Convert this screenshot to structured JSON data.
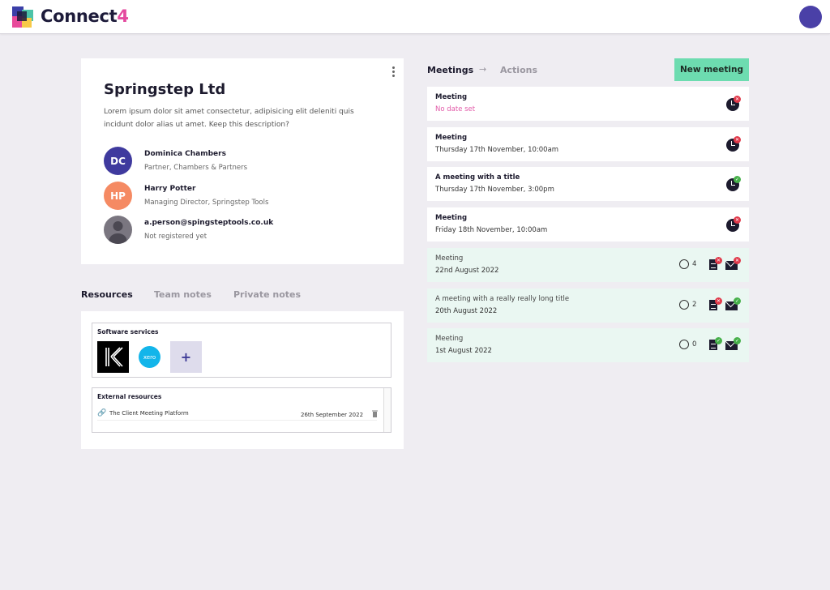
{
  "app": {
    "brand_main": "Connect",
    "brand_accent": "4"
  },
  "company": {
    "name": "Springstep Ltd",
    "description": "Lorem ipsum dolor sit amet consectetur, adipisicing elit deleniti quis incidunt dolor alias ut amet. Keep this description?",
    "contacts": [
      {
        "initials": "DC",
        "name": "Dominica Chambers",
        "role": "Partner, Chambers & Partners",
        "color": "#3f3a9e"
      },
      {
        "initials": "HP",
        "name": "Harry Potter",
        "role": "Managing Director, Springstep Tools",
        "color": "#f58a63"
      },
      {
        "initials": "",
        "name": "a.person@spingsteptools.co.uk",
        "role": "Not registered yet",
        "color": "#7a7680"
      }
    ]
  },
  "tabs": {
    "resources": "Resources",
    "team_notes": "Team notes",
    "private_notes": "Private notes"
  },
  "resources": {
    "software_title": "Software services",
    "xero_label": "xero",
    "add_label": "+",
    "external_title": "External resources",
    "external": [
      {
        "name": "The Client Meeting Platform",
        "date": "26th September 2022"
      }
    ]
  },
  "meetings_header": {
    "meetings": "Meetings",
    "actions": "Actions",
    "arrow": "→",
    "new_button": "New meeting"
  },
  "meetings": [
    {
      "title": "Meeting",
      "date": "No date set",
      "status": "x"
    },
    {
      "title": "Meeting",
      "date": "Thursday 17th November, 10:00am",
      "status": "x"
    },
    {
      "title": "A meeting with a title",
      "date": "Thursday 17th November, 3:00pm",
      "status": "ok"
    },
    {
      "title": "Meeting",
      "date": "Friday 18th November, 10:00am",
      "status": "x"
    }
  ],
  "past_meetings": [
    {
      "title": "Meeting",
      "date": "22nd August 2022",
      "count": "4",
      "doc": "x",
      "mail": "x"
    },
    {
      "title": "A meeting with a really really long title",
      "date": "20th August 2022",
      "count": "2",
      "doc": "x",
      "mail": "ok"
    },
    {
      "title": "Meeting",
      "date": "1st August 2022",
      "count": "0",
      "doc": "ok",
      "mail": "ok"
    }
  ],
  "colors": {
    "accent_green": "#6ddcb0",
    "error_red": "#e0394a",
    "success_green": "#46b04a",
    "pink": "#e25aa8"
  }
}
